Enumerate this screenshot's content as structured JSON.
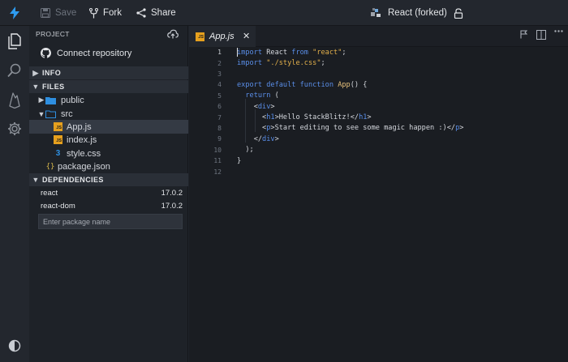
{
  "toolbar": {
    "save_label": "Save",
    "fork_label": "Fork",
    "share_label": "Share",
    "project_title": "React (forked)"
  },
  "sidebar": {
    "project_header": "PROJECT",
    "connect_label": "Connect repository",
    "info_header": "INFO",
    "files_header": "FILES",
    "files": [
      {
        "name": "public",
        "type": "folder",
        "state": "collapsed"
      },
      {
        "name": "src",
        "type": "folder",
        "state": "expanded"
      },
      {
        "name": "App.js",
        "type": "js",
        "selected": true
      },
      {
        "name": "index.js",
        "type": "js"
      },
      {
        "name": "style.css",
        "type": "css"
      },
      {
        "name": "package.json",
        "type": "json"
      }
    ],
    "dependencies_header": "DEPENDENCIES",
    "dependencies": [
      {
        "name": "react",
        "version": "17.0.2"
      },
      {
        "name": "react-dom",
        "version": "17.0.2"
      }
    ],
    "package_placeholder": "Enter package name"
  },
  "editor": {
    "tab_label": "App.js",
    "tab_badge": "JS",
    "close_glyph": "✕",
    "line_numbers": [
      "1",
      "2",
      "3",
      "4",
      "5",
      "6",
      "7",
      "8",
      "9",
      "10",
      "11",
      "12"
    ],
    "lines": [
      "import React from \"react\";",
      "import \"./style.css\";",
      "",
      "export default function App() {",
      "  return (",
      "    <div>",
      "      <h1>Hello StackBlitz!</h1>",
      "      <p>Start editing to see some magic happen :)</p>",
      "    </div>",
      "  );",
      "}",
      ""
    ]
  },
  "colors": {
    "accent": "#2e9cf0",
    "js_badge": "#e6a01e",
    "keyword": "#5a8ee8",
    "string": "#e3b04b"
  }
}
